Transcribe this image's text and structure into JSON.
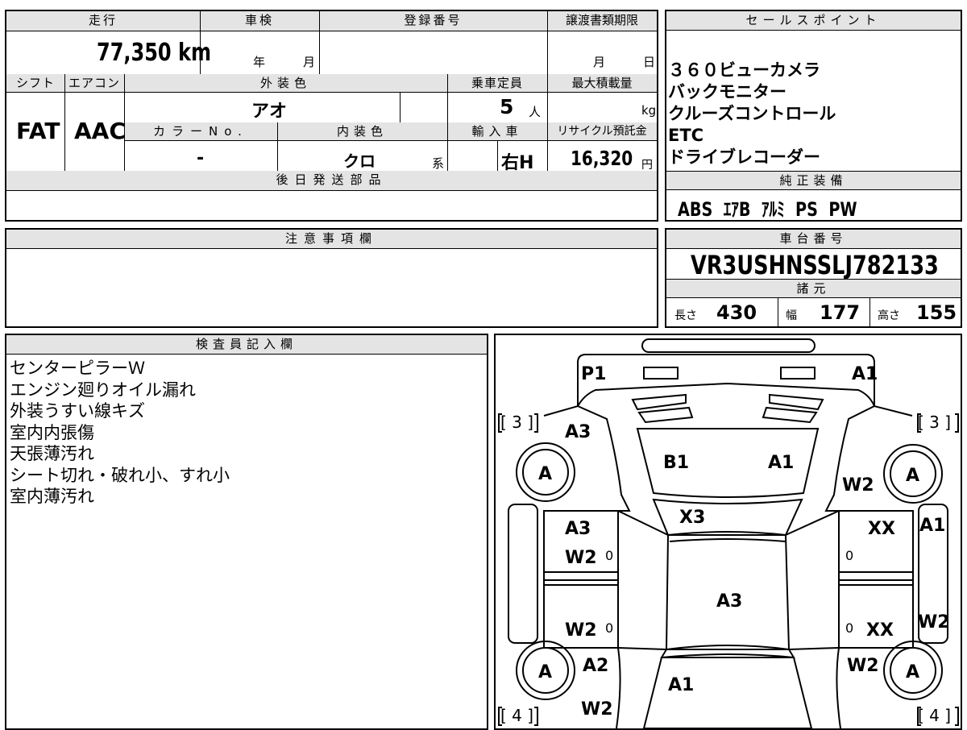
{
  "vehicle": {
    "mileage_label": "走行",
    "mileage": "77,350",
    "mileage_unit": "km",
    "inspection_label": "車検",
    "inspection_year_unit": "年",
    "inspection_month_unit": "月",
    "registration_label": "登録番号",
    "transfer_deadline_label": "譲渡書類期限",
    "transfer_month_unit": "月",
    "transfer_day_unit": "日",
    "shift_label": "シフト",
    "shift": "FAT",
    "ac_label": "エアコン",
    "ac": "AAC",
    "exterior_color_label": "外装色",
    "exterior_color": "アオ",
    "capacity_label": "乗車定員",
    "capacity": "5",
    "capacity_unit": "人",
    "max_load_label": "最大積載量",
    "max_load_unit": "kg",
    "color_no_label": "カラーNo.",
    "color_no": "-",
    "interior_color_label": "内装色",
    "interior_color": "クロ",
    "interior_color_suffix": "系",
    "import_label": "輸入車",
    "import": "右H",
    "recycle_label": "リサイクル預託金",
    "recycle_fee": "16,320",
    "recycle_unit": "円",
    "later_parts_label": "後日発送部品"
  },
  "sales_points": {
    "label": "セールスポイント",
    "items": [
      "３６０ビューカメラ",
      "バックモニター",
      "クルーズコントロール",
      "ETC",
      "ドライブレコーダー"
    ]
  },
  "standard_equipment": {
    "label": "純正装備",
    "items": "ABS  ｴｱB  ｱﾙﾐ  PS  PW"
  },
  "notes": {
    "label": "注意事項欄"
  },
  "chassis": {
    "label": "車台番号",
    "number": "VR3USHNSSLJ782133",
    "specs_label": "諸元",
    "length_label": "長さ",
    "length": "430",
    "width_label": "幅",
    "width": "177",
    "height_label": "高さ",
    "height": "155"
  },
  "inspector": {
    "label": "検査員記入欄",
    "lines": [
      "センターピラーＷ",
      "エンジン廻りオイル漏れ",
      "外装うすい線キズ",
      "室内内張傷",
      "天張薄汚れ",
      "シート切れ・破れ小、すれ小",
      "室内薄汚れ"
    ]
  },
  "diagram": {
    "marks": {
      "front_left": "P1",
      "front_right": "A1",
      "bracket_front_left": "[ 3 ]",
      "bracket_front_right": "[ 3 ]",
      "bracket_rear_left": "[ 4 ]",
      "bracket_rear_right": "[ 4 ]",
      "left_front_fender": "A3",
      "hood_left": "B1",
      "hood_right": "A1",
      "right_front_fender": "W2",
      "wheel": "A",
      "windshield": "X3",
      "left_front_door_1": "A3",
      "left_front_door_2": "W2",
      "right_front_door": "XX",
      "right_sill": "A1",
      "roof": "A3",
      "left_rear_door": "W2",
      "right_rear_door": "XX",
      "right_rear_sill": "W2",
      "left_rear_fender": "A2",
      "right_rear_fender": "W2",
      "trunk": "A1",
      "rear_left": "W2",
      "zero": "0"
    }
  }
}
